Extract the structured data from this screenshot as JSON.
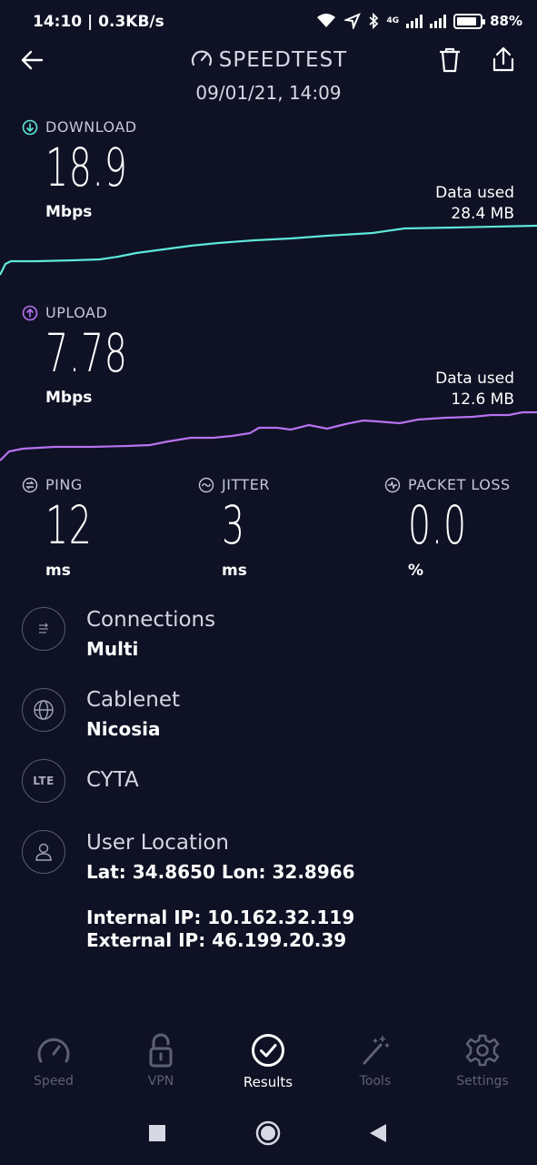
{
  "status_bar": {
    "time": "14:10 | 0.3KB/s",
    "network": "4G",
    "battery": "88%",
    "battery_level": 0.88
  },
  "header": {
    "title": "SPEEDTEST",
    "date": "09/01/21, 14:09",
    "icons": [
      "back-arrow-icon",
      "gauge-icon",
      "trash-icon",
      "share-icon"
    ]
  },
  "download": {
    "label": "DOWNLOAD",
    "value": "18.9",
    "unit": "Mbps",
    "data_used_label": "Data used",
    "data_used": "28.4 MB",
    "color": "#5ee8d8"
  },
  "upload": {
    "label": "UPLOAD",
    "value": "7.78",
    "unit": "Mbps",
    "data_used_label": "Data used",
    "data_used": "12.6 MB",
    "color": "#b772f0"
  },
  "stats": [
    {
      "label": "PING",
      "value": "12",
      "unit": "ms",
      "icon": "ping-icon"
    },
    {
      "label": "JITTER",
      "value": "3",
      "unit": "ms",
      "icon": "jitter-icon"
    },
    {
      "label": "PACKET LOSS",
      "value": "0.0",
      "unit": "%",
      "icon": "packet-loss-icon"
    }
  ],
  "info": {
    "connections": {
      "title": "Connections",
      "value": "Multi"
    },
    "provider": {
      "title": "Cablenet",
      "value": "Nicosia"
    },
    "carrier": {
      "badge": "LTE",
      "title": "CYTA"
    },
    "location": {
      "title": "User Location",
      "coords": "Lat: 34.8650 Lon: 32.8966",
      "internal_ip": "Internal IP: 10.162.32.119",
      "external_ip": "External IP: 46.199.20.39"
    }
  },
  "nav": [
    {
      "label": "Speed",
      "icon": "speedometer-icon",
      "active": false
    },
    {
      "label": "VPN",
      "icon": "lock-icon",
      "active": false
    },
    {
      "label": "Results",
      "icon": "check-circle-icon",
      "active": true
    },
    {
      "label": "Tools",
      "icon": "magic-wand-icon",
      "active": false
    },
    {
      "label": "Settings",
      "icon": "gear-icon",
      "active": false
    }
  ],
  "system_nav": [
    "recents-square-icon",
    "home-circle-icon",
    "back-triangle-icon"
  ]
}
